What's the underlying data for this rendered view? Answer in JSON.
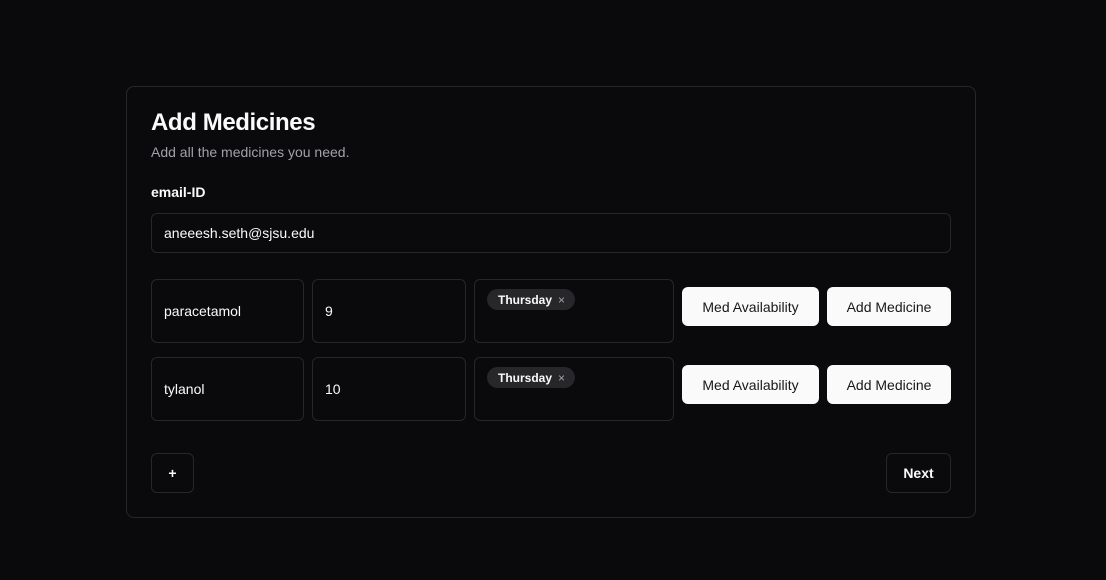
{
  "form": {
    "title": "Add Medicines",
    "subtitle": "Add all the medicines you need.",
    "email_label": "email-ID",
    "email_value": "aneeesh.seth@sjsu.edu"
  },
  "medicines": [
    {
      "name": "paracetamol",
      "quantity": "9",
      "days": [
        "Thursday"
      ],
      "availability_label": "Med Availability",
      "add_label": "Add Medicine"
    },
    {
      "name": "tylanol",
      "quantity": "10",
      "days": [
        "Thursday"
      ],
      "availability_label": "Med Availability",
      "add_label": "Add Medicine"
    }
  ],
  "chip_remove_symbol": "×",
  "actions": {
    "add_row_label": "+",
    "next_label": "Next"
  },
  "colors": {
    "background": "#0a0a0c",
    "border": "#27272a",
    "primary_button": "#fafafa",
    "chip": "#27272a",
    "muted_text": "#a1a1aa"
  },
  "icons": [
    "plus-icon",
    "close-icon"
  ]
}
